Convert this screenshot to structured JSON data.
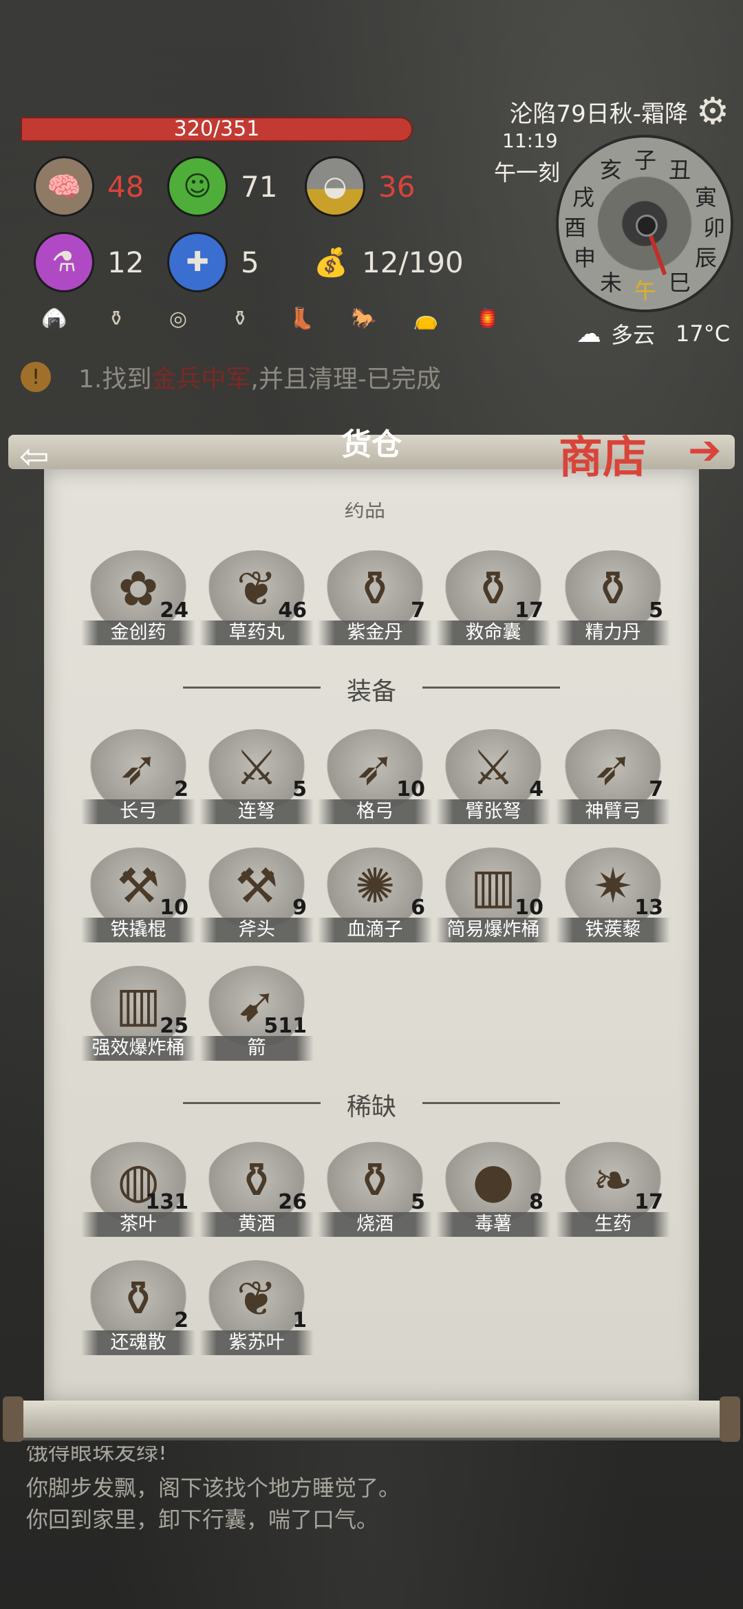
{
  "hud": {
    "hp": "320/351",
    "stats": [
      {
        "name": "brain",
        "value": "48",
        "color": "#d9443a"
      },
      {
        "name": "mood",
        "value": "71",
        "color": "#e8e4da"
      },
      {
        "name": "stomach",
        "value": "36",
        "color": "#d9443a"
      }
    ],
    "stats2": [
      {
        "name": "potion",
        "value": "12"
      },
      {
        "name": "bandage",
        "value": "5"
      },
      {
        "name": "bags",
        "value": "12/190"
      }
    ],
    "small_icons": [
      "rice-icon",
      "bottle-icon",
      "coins-icon",
      "vase-icon",
      "boots-icon",
      "horse-icon",
      "pouch-icon",
      "lantern-icon"
    ]
  },
  "quest": {
    "prefix": "1.找到",
    "highlight": "金兵中军",
    "suffix": ",并且清理-已完成"
  },
  "clock": {
    "date": "沦陷79日秋-霜降",
    "time": "11:19",
    "period": "午一刻",
    "branches": [
      "子",
      "丑",
      "寅",
      "卯",
      "辰",
      "巳",
      "午",
      "未",
      "申",
      "酉",
      "戌",
      "亥"
    ],
    "weather": "多云",
    "temperature": "17°C"
  },
  "panel": {
    "title": "货仓",
    "shop": "商店",
    "cut_label": "药品"
  },
  "sections": {
    "equip": "装备",
    "rare": "稀缺"
  },
  "items_medicine": [
    {
      "name": "金创药",
      "count": "24",
      "icon": "✿"
    },
    {
      "name": "草药丸",
      "count": "46",
      "icon": "❦"
    },
    {
      "name": "紫金丹",
      "count": "7",
      "icon": "⚱"
    },
    {
      "name": "救命囊",
      "count": "17",
      "icon": "⚱"
    },
    {
      "name": "精力丹",
      "count": "5",
      "icon": "⚱"
    }
  ],
  "items_equip": [
    {
      "name": "长弓",
      "count": "2",
      "icon": "➶"
    },
    {
      "name": "连弩",
      "count": "5",
      "icon": "⚔"
    },
    {
      "name": "格弓",
      "count": "10",
      "icon": "➶"
    },
    {
      "name": "臂张弩",
      "count": "4",
      "icon": "⚔"
    },
    {
      "name": "神臂弓",
      "count": "7",
      "icon": "➶"
    },
    {
      "name": "铁撬棍",
      "count": "10",
      "icon": "⚒"
    },
    {
      "name": "斧头",
      "count": "9",
      "icon": "⚒"
    },
    {
      "name": "血滴子",
      "count": "6",
      "icon": "✺"
    },
    {
      "name": "简易爆炸桶",
      "count": "10",
      "icon": "▥"
    },
    {
      "name": "铁蒺藜",
      "count": "13",
      "icon": "✷"
    },
    {
      "name": "强效爆炸桶",
      "count": "25",
      "icon": "▥"
    },
    {
      "name": "箭",
      "count": "511",
      "icon": "➹"
    }
  ],
  "items_rare": [
    {
      "name": "茶叶",
      "count": "131",
      "icon": "◍"
    },
    {
      "name": "黄酒",
      "count": "26",
      "icon": "⚱"
    },
    {
      "name": "烧酒",
      "count": "5",
      "icon": "⚱"
    },
    {
      "name": "毒薯",
      "count": "8",
      "icon": "●"
    },
    {
      "name": "生药",
      "count": "17",
      "icon": "❧"
    },
    {
      "name": "还魂散",
      "count": "2",
      "icon": "⚱"
    },
    {
      "name": "紫苏叶",
      "count": "1",
      "icon": "❦"
    }
  ],
  "log": [
    "饿得眼珠发绿!",
    "你脚步发飘，阁下该找个地方睡觉了。",
    "你回到家里，卸下行囊，喘了口气。"
  ],
  "colors": {
    "accent_red": "#d9443a",
    "hp_bar": "#c23a32",
    "paper": "#e3e1d9"
  }
}
